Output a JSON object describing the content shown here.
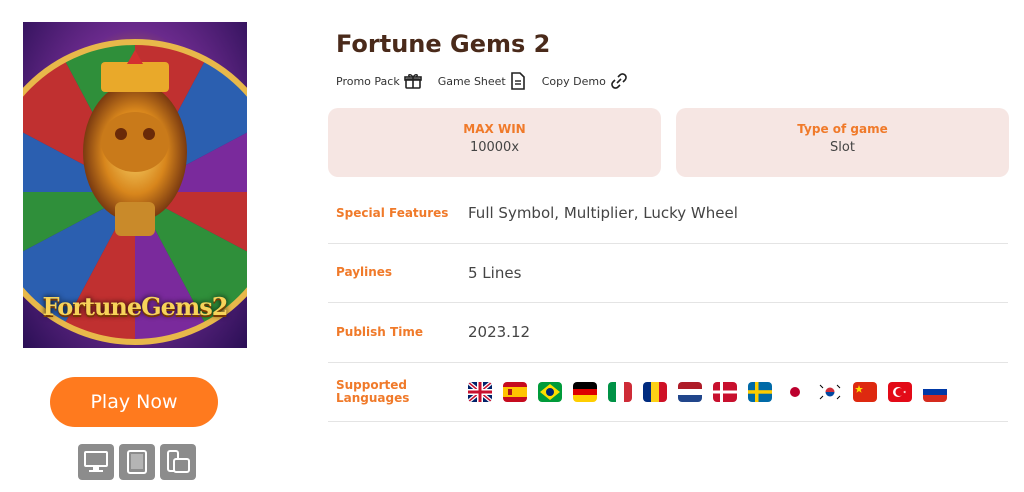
{
  "game": {
    "title": "Fortune Gems 2",
    "art_title": "FortuneGems2"
  },
  "links": [
    {
      "label": "Promo Pack",
      "icon": "gift-box-icon"
    },
    {
      "label": "Game Sheet",
      "icon": "document-icon"
    },
    {
      "label": "Copy Demo",
      "icon": "link-icon"
    }
  ],
  "cards": {
    "max_win_label": "MAX WIN",
    "max_win_value": "10000x",
    "type_label": "Type of game",
    "type_value": "Slot"
  },
  "details": {
    "features_label": "Special Features",
    "features_value": "Full Symbol, Multiplier, Lucky Wheel",
    "paylines_label": "Paylines",
    "paylines_value": "5 Lines",
    "publish_label": "Publish Time",
    "publish_value": "2023.12",
    "languages_label": "Supported Languages"
  },
  "languages": [
    "english-uk-flag",
    "spain-flag",
    "brazil-flag",
    "germany-flag",
    "italy-flag",
    "romania-flag",
    "netherlands-flag",
    "denmark-flag",
    "sweden-flag",
    "japan-flag",
    "korea-flag",
    "china-flag",
    "turkey-flag",
    "russia-flag"
  ],
  "play_button": "Play Now",
  "devices": [
    "desktop-icon",
    "tablet-icon",
    "mobile-icon"
  ],
  "colors": {
    "accent": "#ff7a1e",
    "label": "#f07a2a",
    "card_bg": "#f6e6e3",
    "title": "#4a2a1a"
  }
}
